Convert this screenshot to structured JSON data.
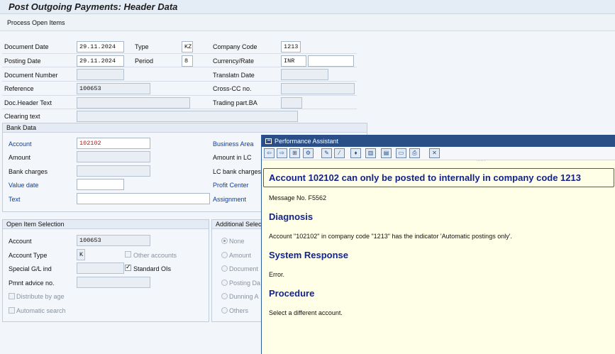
{
  "window": {
    "title": "Post Outgoing Payments: Header Data"
  },
  "toolbar": {
    "process_open_items": "Process Open Items"
  },
  "header": {
    "document_date_label": "Document Date",
    "document_date": "29.11.2024",
    "type_label": "Type",
    "type": "KZ",
    "company_code_label": "Company Code",
    "company_code": "1213",
    "posting_date_label": "Posting Date",
    "posting_date": "29.11.2024",
    "period_label": "Period",
    "period": "8",
    "currency_rate_label": "Currency/Rate",
    "currency": "INR",
    "rate": "",
    "document_number_label": "Document Number",
    "document_number": "",
    "translation_date_label": "Translatn Date",
    "translation_date": "",
    "reference_label": "Reference",
    "reference": "100653",
    "cross_cc_label": "Cross-CC no.",
    "cross_cc": "",
    "doc_header_text_label": "Doc.Header Text",
    "doc_header_text": "",
    "trading_part_label": "Trading part.BA",
    "trading_part": "",
    "clearing_text_label": "Clearing text",
    "clearing_text": ""
  },
  "bank_data": {
    "title": "Bank Data",
    "account_label": "Account",
    "account": "102102",
    "business_area_label": "Business Area",
    "amount_label": "Amount",
    "amount": "",
    "amount_lc_label": "Amount in LC",
    "bank_charges_label": "Bank charges",
    "bank_charges": "",
    "lc_bank_charges_label": "LC bank charges",
    "value_date_label": "Value date",
    "value_date": "",
    "profit_center_label": "Profit Center",
    "text_label": "Text",
    "text": "",
    "assignment_label": "Assignment"
  },
  "open_item_selection": {
    "title": "Open Item Selection",
    "account_label": "Account",
    "account": "100653",
    "account_type_label": "Account Type",
    "account_type": "K",
    "other_accounts_label": "Other accounts",
    "special_gl_label": "Special G/L ind",
    "special_gl": "",
    "standard_ois_label": "Standard OIs",
    "pmnt_advice_label": "Pmnt advice no.",
    "pmnt_advice": "",
    "distribute_label": "Distribute by age",
    "automatic_search_label": "Automatic search"
  },
  "additional_selections": {
    "title": "Additional Selec",
    "options": [
      "None",
      "Amount",
      "Document",
      "Posting Da",
      "Dunning A",
      "Others"
    ]
  },
  "performance_assistant": {
    "title": "Performance Assistant",
    "toolbar_dots": ".....",
    "headline": "Account 102102 can only be posted to internally in company code 1213",
    "message_no": "Message No. F5562",
    "diagnosis_title": "Diagnosis",
    "diagnosis_text": "Account \"102102\" in company code \"1213\" has the indicator 'Automatic postings only'.",
    "system_response_title": "System Response",
    "system_response_text": "Error.",
    "procedure_title": "Procedure",
    "procedure_text": "Select a different account."
  },
  "colors": {
    "title_bar": "#2a4f86",
    "heading": "#13238a",
    "highlight_border": "#b8352e",
    "account_value": "#c01010",
    "label_blue": "#0a3fa8"
  },
  "icons": [
    "back-icon",
    "forward-icon",
    "print-preview-icon",
    "settings-icon",
    "edit-icon",
    "wand-icon",
    "help-icon",
    "book-icon",
    "technical-info-icon",
    "export-icon",
    "print-icon",
    "close-icon"
  ]
}
